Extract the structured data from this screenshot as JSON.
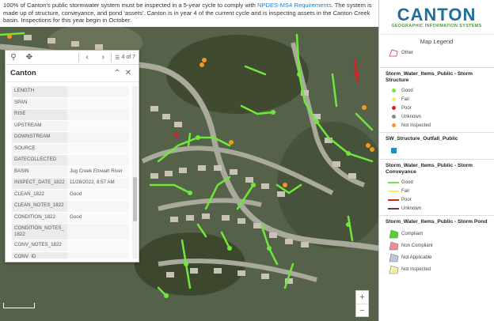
{
  "intro": {
    "text_before": "100% of Canton's public stormwater system must be inspected in a 5-year cycle to comply with ",
    "link": "NPDES-MS4 Requirements",
    "text_after": ". The system is made up of structure, conveyance, and pond 'assets'. Canton is in year 4 of the current cycle and is inspecting assets in the Canton Creek basin. Inspections for this year begin in October."
  },
  "popup": {
    "pager": "4 of 7",
    "title": "Canton",
    "fields": [
      {
        "k": "LENGTH",
        "v": ""
      },
      {
        "k": "SPAN",
        "v": ""
      },
      {
        "k": "RISE",
        "v": ""
      },
      {
        "k": "UPSTREAM",
        "v": ""
      },
      {
        "k": "DOWNSTREAM",
        "v": ""
      },
      {
        "k": "SOURCE",
        "v": ""
      },
      {
        "k": "DATECOLLECTED",
        "v": ""
      },
      {
        "k": "BASIN",
        "v": "Jug Creek Etowah River"
      },
      {
        "k": "INSPECT_DATE_1822",
        "v": "11/28/2022, 8:57 AM"
      },
      {
        "k": "CLEAN_1822",
        "v": "Good"
      },
      {
        "k": "CLEAN_NOTES_1822",
        "v": ""
      },
      {
        "k": "CONDITION_1822",
        "v": "Good"
      },
      {
        "k": "CONDITION_NOTES_ 1822",
        "v": ""
      },
      {
        "k": "CONV_NOTES_1822",
        "v": ""
      },
      {
        "k": "CONV_ID",
        "v": ""
      }
    ]
  },
  "legend": {
    "logo": {
      "name": "CANTON",
      "subtitle": "GEOGRAPHIC INFORMATION SYSTEMS"
    },
    "title": "Map Legend",
    "other_label": "Other",
    "structure": {
      "heading": "Storm_Water_Items_Public - Storm Structure",
      "items": [
        {
          "label": "Good",
          "color": "#6ee83a"
        },
        {
          "label": "Fair",
          "color": "#f4f14a"
        },
        {
          "label": "Poor",
          "color": "#d6202a"
        },
        {
          "label": "Unknown",
          "color": "#8a8a8a"
        },
        {
          "label": "Not Inspected",
          "color": "#f39a1e"
        }
      ]
    },
    "outfall": {
      "heading": "SW_Structure_Outfall_Public",
      "color": "#1a8fd6"
    },
    "conveyance": {
      "heading": "Storm_Water_Items_Public - Storm Conveyance",
      "items": [
        {
          "label": "Good",
          "color": "#6ee83a"
        },
        {
          "label": "Fair",
          "color": "#f4f14a"
        },
        {
          "label": "Poor",
          "color": "#d6202a"
        },
        {
          "label": "Unknown",
          "color": "#6b3a3a"
        }
      ]
    },
    "pond": {
      "heading": "Storm_Water_Items_Public - Storm Pond",
      "items": [
        {
          "label": "Compliant",
          "color": "#4fd42c"
        },
        {
          "label": "Non Compliant",
          "color": "#f08c98"
        },
        {
          "label": "Not Applicable",
          "color": "#b9c7e3"
        },
        {
          "label": "Not Inspected",
          "color": "#f6f3a2"
        }
      ]
    }
  },
  "map": {
    "zoom_in": "+",
    "zoom_out": "−"
  }
}
